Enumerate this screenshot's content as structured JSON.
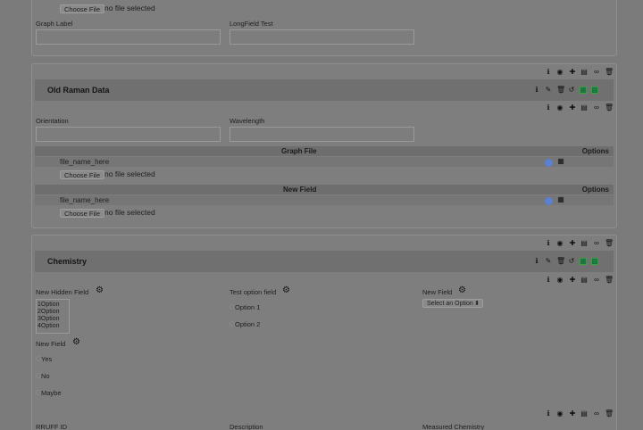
{
  "top_panel": {
    "file_button_label": "Choose File",
    "file_status": "no file selected",
    "graph_label": "Graph Label",
    "longfield_label": "LongField Test"
  },
  "old_raman": {
    "title": "Old Raman Data",
    "orientation_label": "Orientation",
    "wavelength_label": "Wavelength",
    "table1": {
      "columns": [
        "Graph File",
        "Options"
      ],
      "file_name": "file_name_here",
      "file_button_label": "Choose File",
      "file_status": "no file selected"
    },
    "table2": {
      "columns": [
        "New Field",
        "Options"
      ],
      "file_name": "file_name_here",
      "file_button_label": "Choose File",
      "file_status": "no file selected"
    }
  },
  "chemistry": {
    "title": "Chemistry",
    "hidden_field_label": "New Hidden Field",
    "hidden_options": [
      "1Option",
      "2Option",
      "3Option",
      "4Option"
    ],
    "test_option_label": "Test option field",
    "test_options": [
      "Option 1",
      "Option 2"
    ],
    "new_field_select_label": "New Field",
    "select_placeholder": "Select an Option",
    "new_field_radio_label": "New Field",
    "radio_options": [
      "Yes",
      "No",
      "Maybe"
    ]
  },
  "bottom_labels": {
    "rruff_id": "RRUFF ID",
    "description": "Description",
    "measured_chemistry": "Measured Chemistry"
  },
  "colors": {
    "accent_green": "#3ca33c",
    "globe_blue": "#5b7fd1"
  },
  "icons": {
    "row_actions": [
      "info-icon",
      "eye-icon",
      "plus-icon",
      "table-icon",
      "link-icon",
      "trash-icon"
    ],
    "bar_actions": [
      "info-icon",
      "edit-icon",
      "trash-icon",
      "undo-icon",
      "chart-icon",
      "grid-icon"
    ],
    "file_options": [
      "globe-icon",
      "calendar-icon"
    ]
  }
}
